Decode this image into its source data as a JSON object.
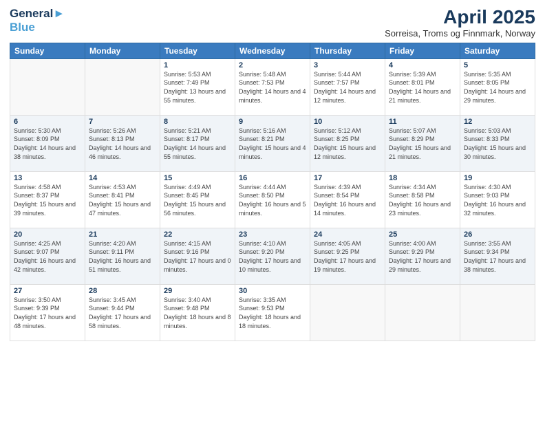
{
  "header": {
    "logo_line1": "General",
    "logo_line2": "Blue",
    "title": "April 2025",
    "location": "Sorreisa, Troms og Finnmark, Norway"
  },
  "weekdays": [
    "Sunday",
    "Monday",
    "Tuesday",
    "Wednesday",
    "Thursday",
    "Friday",
    "Saturday"
  ],
  "weeks": [
    [
      {
        "day": "",
        "info": ""
      },
      {
        "day": "",
        "info": ""
      },
      {
        "day": "1",
        "info": "Sunrise: 5:53 AM\nSunset: 7:49 PM\nDaylight: 13 hours and 55 minutes."
      },
      {
        "day": "2",
        "info": "Sunrise: 5:48 AM\nSunset: 7:53 PM\nDaylight: 14 hours and 4 minutes."
      },
      {
        "day": "3",
        "info": "Sunrise: 5:44 AM\nSunset: 7:57 PM\nDaylight: 14 hours and 12 minutes."
      },
      {
        "day": "4",
        "info": "Sunrise: 5:39 AM\nSunset: 8:01 PM\nDaylight: 14 hours and 21 minutes."
      },
      {
        "day": "5",
        "info": "Sunrise: 5:35 AM\nSunset: 8:05 PM\nDaylight: 14 hours and 29 minutes."
      }
    ],
    [
      {
        "day": "6",
        "info": "Sunrise: 5:30 AM\nSunset: 8:09 PM\nDaylight: 14 hours and 38 minutes."
      },
      {
        "day": "7",
        "info": "Sunrise: 5:26 AM\nSunset: 8:13 PM\nDaylight: 14 hours and 46 minutes."
      },
      {
        "day": "8",
        "info": "Sunrise: 5:21 AM\nSunset: 8:17 PM\nDaylight: 14 hours and 55 minutes."
      },
      {
        "day": "9",
        "info": "Sunrise: 5:16 AM\nSunset: 8:21 PM\nDaylight: 15 hours and 4 minutes."
      },
      {
        "day": "10",
        "info": "Sunrise: 5:12 AM\nSunset: 8:25 PM\nDaylight: 15 hours and 12 minutes."
      },
      {
        "day": "11",
        "info": "Sunrise: 5:07 AM\nSunset: 8:29 PM\nDaylight: 15 hours and 21 minutes."
      },
      {
        "day": "12",
        "info": "Sunrise: 5:03 AM\nSunset: 8:33 PM\nDaylight: 15 hours and 30 minutes."
      }
    ],
    [
      {
        "day": "13",
        "info": "Sunrise: 4:58 AM\nSunset: 8:37 PM\nDaylight: 15 hours and 39 minutes."
      },
      {
        "day": "14",
        "info": "Sunrise: 4:53 AM\nSunset: 8:41 PM\nDaylight: 15 hours and 47 minutes."
      },
      {
        "day": "15",
        "info": "Sunrise: 4:49 AM\nSunset: 8:45 PM\nDaylight: 15 hours and 56 minutes."
      },
      {
        "day": "16",
        "info": "Sunrise: 4:44 AM\nSunset: 8:50 PM\nDaylight: 16 hours and 5 minutes."
      },
      {
        "day": "17",
        "info": "Sunrise: 4:39 AM\nSunset: 8:54 PM\nDaylight: 16 hours and 14 minutes."
      },
      {
        "day": "18",
        "info": "Sunrise: 4:34 AM\nSunset: 8:58 PM\nDaylight: 16 hours and 23 minutes."
      },
      {
        "day": "19",
        "info": "Sunrise: 4:30 AM\nSunset: 9:03 PM\nDaylight: 16 hours and 32 minutes."
      }
    ],
    [
      {
        "day": "20",
        "info": "Sunrise: 4:25 AM\nSunset: 9:07 PM\nDaylight: 16 hours and 42 minutes."
      },
      {
        "day": "21",
        "info": "Sunrise: 4:20 AM\nSunset: 9:11 PM\nDaylight: 16 hours and 51 minutes."
      },
      {
        "day": "22",
        "info": "Sunrise: 4:15 AM\nSunset: 9:16 PM\nDaylight: 17 hours and 0 minutes."
      },
      {
        "day": "23",
        "info": "Sunrise: 4:10 AM\nSunset: 9:20 PM\nDaylight: 17 hours and 10 minutes."
      },
      {
        "day": "24",
        "info": "Sunrise: 4:05 AM\nSunset: 9:25 PM\nDaylight: 17 hours and 19 minutes."
      },
      {
        "day": "25",
        "info": "Sunrise: 4:00 AM\nSunset: 9:29 PM\nDaylight: 17 hours and 29 minutes."
      },
      {
        "day": "26",
        "info": "Sunrise: 3:55 AM\nSunset: 9:34 PM\nDaylight: 17 hours and 38 minutes."
      }
    ],
    [
      {
        "day": "27",
        "info": "Sunrise: 3:50 AM\nSunset: 9:39 PM\nDaylight: 17 hours and 48 minutes."
      },
      {
        "day": "28",
        "info": "Sunrise: 3:45 AM\nSunset: 9:44 PM\nDaylight: 17 hours and 58 minutes."
      },
      {
        "day": "29",
        "info": "Sunrise: 3:40 AM\nSunset: 9:48 PM\nDaylight: 18 hours and 8 minutes."
      },
      {
        "day": "30",
        "info": "Sunrise: 3:35 AM\nSunset: 9:53 PM\nDaylight: 18 hours and 18 minutes."
      },
      {
        "day": "",
        "info": ""
      },
      {
        "day": "",
        "info": ""
      },
      {
        "day": "",
        "info": ""
      }
    ]
  ]
}
